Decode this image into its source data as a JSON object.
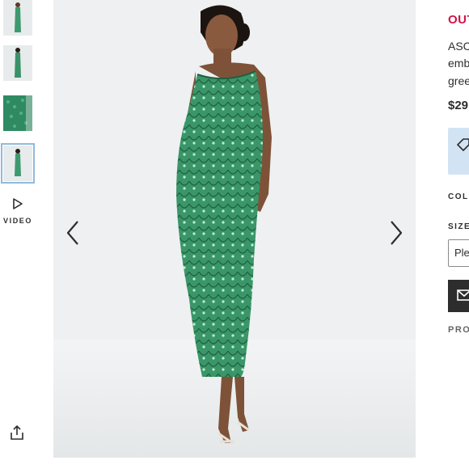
{
  "gallery": {
    "thumbnails": [
      {
        "name": "thumbnail-front",
        "selected": false
      },
      {
        "name": "thumbnail-back",
        "selected": false
      },
      {
        "name": "thumbnail-detail",
        "selected": false
      },
      {
        "name": "thumbnail-full",
        "selected": true
      }
    ],
    "video_label": "VIDEO",
    "icons": {
      "video": "play-icon",
      "share": "share-icon",
      "prev": "chevron-left-icon",
      "next": "chevron-right-icon"
    }
  },
  "product": {
    "brand": "OUT",
    "name_line_1": "ASC",
    "name_line_2": "emb",
    "name_line_3": "gree",
    "price": "$29",
    "colour_label": "COLO",
    "size_label": "SIZE:",
    "size_select_text": "Ple",
    "extra_label": "PRO"
  },
  "colors": {
    "brand_accent": "#d01345",
    "dress_green": "#3e9a6e",
    "promo_bg": "#d2e4f4",
    "dark": "#2d2d2d"
  }
}
